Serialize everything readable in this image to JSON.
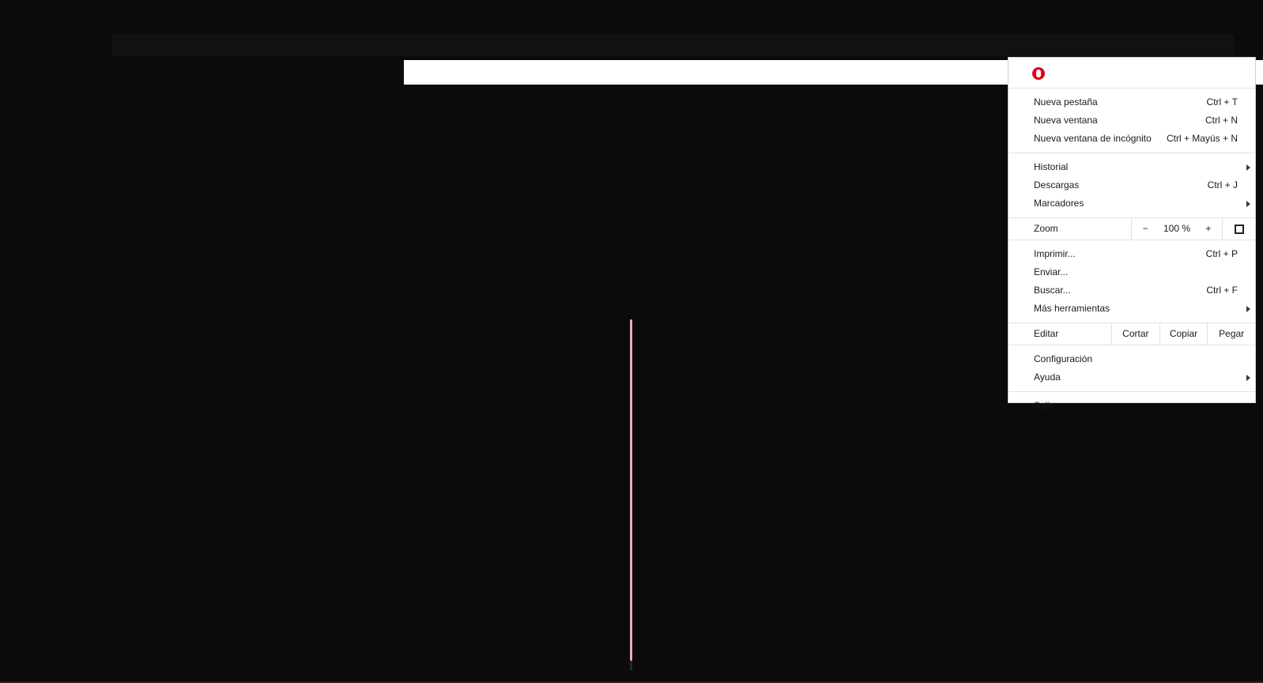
{
  "menu": {
    "brand_icon": "opera-hand-icon",
    "group1": [
      {
        "label": "Nueva pestaña",
        "shortcut": "Ctrl + T"
      },
      {
        "label": "Nueva ventana",
        "shortcut": "Ctrl + N"
      },
      {
        "label": "Nueva ventana de incógnito",
        "shortcut": "Ctrl + Mayús + N"
      }
    ],
    "group2": [
      {
        "label": "Historial",
        "shortcut": ""
      },
      {
        "label": "Descargas",
        "shortcut": "Ctrl + J"
      },
      {
        "label": "Marcadores",
        "shortcut": ""
      }
    ],
    "zoom": {
      "label": "Zoom",
      "minus": "−",
      "value": "100 %",
      "plus": "+"
    },
    "group3": [
      {
        "label": "Imprimir...",
        "shortcut": "Ctrl + P"
      },
      {
        "label": "Enviar...",
        "shortcut": ""
      },
      {
        "label": "Buscar...",
        "shortcut": "Ctrl + F"
      },
      {
        "label": "Más herramientas",
        "shortcut": ""
      }
    ],
    "edit": {
      "label": "Editar",
      "cut": "Cortar",
      "copy": "Copiar",
      "paste": "Pegar"
    },
    "group4": [
      {
        "label": "Configuración"
      },
      {
        "label": "Ayuda"
      }
    ],
    "exit": {
      "label": "Salir"
    }
  },
  "colors": {
    "background": "#0b0b0b",
    "accent_pink": "#f3a6bd",
    "brand_red": "#e0001b"
  }
}
